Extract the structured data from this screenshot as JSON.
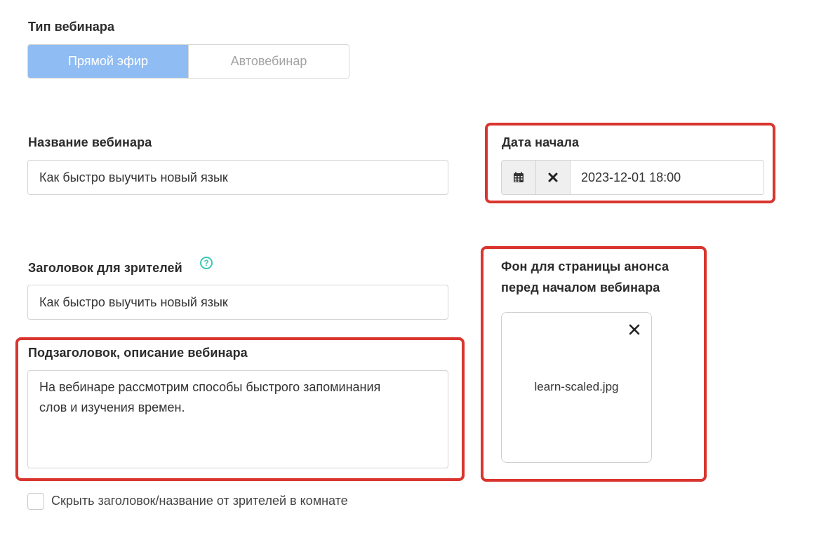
{
  "webinar_type": {
    "label": "Тип вебинара",
    "options": [
      "Прямой эфир",
      "Автовебинар"
    ],
    "selected": "Прямой эфир"
  },
  "webinar_name": {
    "label": "Название вебинара",
    "value": "Как быстро выучить новый язык"
  },
  "start_date": {
    "label": "Дата начала",
    "value": "2023-12-01 18:00",
    "icons": [
      "calendar-icon",
      "clear-icon"
    ]
  },
  "viewer_title": {
    "label": "Заголовок для зрителей",
    "help_icon": "?",
    "value": "Как быстро выучить новый язык"
  },
  "subtitle": {
    "label": "Подзаголовок, описание вебинара",
    "value": "На вебинаре рассмотрим способы быстрого запоминания\nслов и изучения времен."
  },
  "background": {
    "label_line1": "Фон для страницы анонса",
    "label_line2": "перед началом вебинара",
    "file_name": "learn-scaled.jpg",
    "remove_icon": "close-icon"
  },
  "hide_title": {
    "label": "Скрыть заголовок/название от зрителей в комнате",
    "checked": false
  },
  "colors": {
    "accent": "#8fbcf3",
    "highlight": "#d9352e",
    "help": "#3cc7b5"
  }
}
